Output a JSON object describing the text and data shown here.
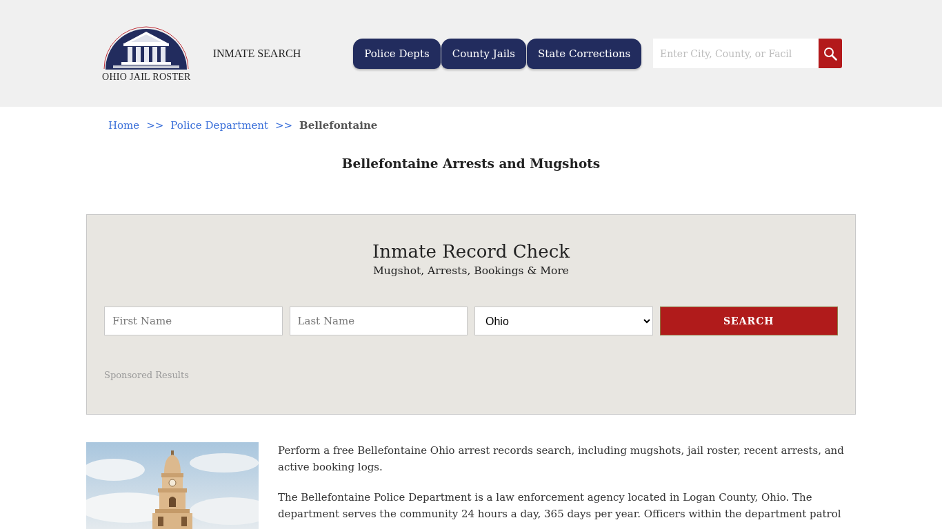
{
  "header": {
    "logo": {
      "text": "OHIO JAIL ROSTER"
    },
    "inmate_search_link": "INMATE SEARCH",
    "nav": [
      {
        "label": "Police Depts"
      },
      {
        "label": "County Jails"
      },
      {
        "label": "State Corrections"
      }
    ],
    "search": {
      "placeholder": "Enter City, County, or Facil"
    }
  },
  "breadcrumb": [
    {
      "kind": "link",
      "label": "Home"
    },
    {
      "kind": "separator",
      "label": ">>"
    },
    {
      "kind": "link",
      "label": "Police Department"
    },
    {
      "kind": "separator",
      "label": ">>"
    },
    {
      "kind": "current",
      "label": "Bellefontaine"
    }
  ],
  "page_title": "Bellefontaine Arrests and Mugshots",
  "record_check": {
    "title": "Inmate Record Check",
    "subtitle": "Mugshot, Arrests, Bookings & More",
    "form": [
      {
        "kind": "input",
        "placeholder": "First Name"
      },
      {
        "kind": "input",
        "placeholder": "Last Name"
      },
      {
        "kind": "select",
        "value": "Ohio"
      },
      {
        "kind": "button",
        "label": "SEARCH"
      }
    ],
    "sponsored_label": "Sponsored Results"
  },
  "article": {
    "paragraphs": [
      "Perform a free Bellefontaine Ohio arrest records search, including mugshots, jail roster, recent arrests, and active booking logs.",
      "The Bellefontaine Police Department is a law enforcement agency located in Logan County, Ohio. The department serves the community 24 hours a day, 365 days per year. Officers within the department patrol"
    ]
  }
}
